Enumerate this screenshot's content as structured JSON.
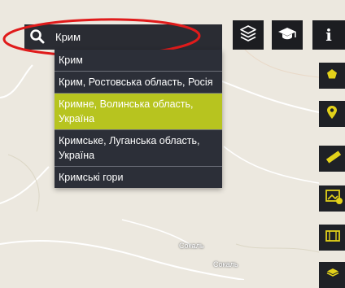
{
  "search": {
    "value": "Крим",
    "icon": "search-icon"
  },
  "suggestions": [
    {
      "label": "Крим",
      "selected": false
    },
    {
      "label": "Крим, Ростовська область, Росія",
      "selected": false
    },
    {
      "label": "Кримне, Волинська область, Україна",
      "selected": true
    },
    {
      "label": "Кримське, Луганська область, Україна",
      "selected": false
    },
    {
      "label": "Кримські гори",
      "selected": false
    }
  ],
  "toolbar": {
    "layers_icon": "layers-icon",
    "education_icon": "graduation-cap-icon",
    "info_icon": "info-icon",
    "info_label": "i"
  },
  "side_tools": [
    {
      "icon": "pentagon-icon"
    },
    {
      "icon": "map-marker-icon"
    },
    {
      "icon": "ruler-icon"
    },
    {
      "icon": "image-add-icon"
    },
    {
      "icon": "film-icon"
    },
    {
      "icon": "cube-icon"
    }
  ],
  "map_labels": {
    "place1": "Сокаль",
    "place2": "Сокаль"
  },
  "colors": {
    "panel": "#2c2f38",
    "selected": "#b7c41f",
    "accent_yellow": "#e3d21a",
    "annotation_red": "#e01b1b"
  }
}
